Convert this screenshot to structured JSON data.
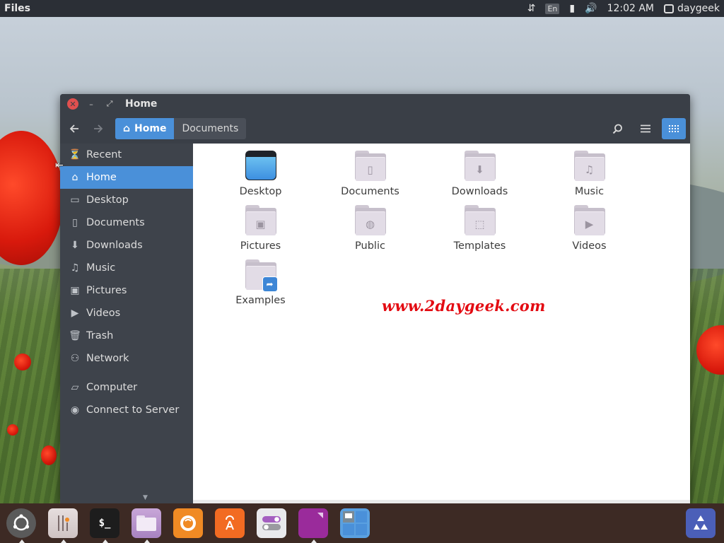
{
  "top_panel": {
    "app_title": "Files",
    "language": "En",
    "time": "12:02 AM",
    "user": "daygeek"
  },
  "window": {
    "title": "Home",
    "pathbar": [
      {
        "label": "Home",
        "active": true
      },
      {
        "label": "Documents",
        "active": false
      }
    ]
  },
  "sidebar": {
    "items": [
      {
        "label": "Recent",
        "icon": "clock-icon",
        "glyph": "⏳"
      },
      {
        "label": "Home",
        "icon": "home-icon",
        "glyph": "⌂"
      },
      {
        "label": "Desktop",
        "icon": "desktop-icon",
        "glyph": "▭"
      },
      {
        "label": "Documents",
        "icon": "document-icon",
        "glyph": "▯"
      },
      {
        "label": "Downloads",
        "icon": "download-icon",
        "glyph": "⬇"
      },
      {
        "label": "Music",
        "icon": "music-icon",
        "glyph": "♫"
      },
      {
        "label": "Pictures",
        "icon": "picture-icon",
        "glyph": "▣"
      },
      {
        "label": "Videos",
        "icon": "video-icon",
        "glyph": "▶"
      },
      {
        "label": "Trash",
        "icon": "trash-icon",
        "glyph": "🗑"
      },
      {
        "label": "Network",
        "icon": "network-icon",
        "glyph": "⚇"
      }
    ],
    "devices": [
      {
        "label": "Computer",
        "icon": "computer-icon",
        "glyph": "▱"
      },
      {
        "label": "Connect to Server",
        "icon": "globe-icon",
        "glyph": "◉"
      }
    ]
  },
  "files": [
    {
      "name": "Desktop",
      "icon": "desktop-folder-icon",
      "glyph": ""
    },
    {
      "name": "Documents",
      "icon": "documents-folder-icon",
      "glyph": "▯"
    },
    {
      "name": "Downloads",
      "icon": "downloads-folder-icon",
      "glyph": "⬇"
    },
    {
      "name": "Music",
      "icon": "music-folder-icon",
      "glyph": "♫"
    },
    {
      "name": "Pictures",
      "icon": "pictures-folder-icon",
      "glyph": "▣"
    },
    {
      "name": "Public",
      "icon": "public-folder-icon",
      "glyph": "◍"
    },
    {
      "name": "Templates",
      "icon": "templates-folder-icon",
      "glyph": "⬚"
    },
    {
      "name": "Videos",
      "icon": "videos-folder-icon",
      "glyph": "▶"
    },
    {
      "name": "Examples",
      "icon": "examples-folder-icon",
      "glyph": ""
    }
  ],
  "watermark": "www.2daygeek.com",
  "dock": {
    "terminal_text": "$_"
  },
  "colors": {
    "accent": "#4a90d9",
    "close_button": "#e0504f",
    "watermark": "#e30b12"
  }
}
